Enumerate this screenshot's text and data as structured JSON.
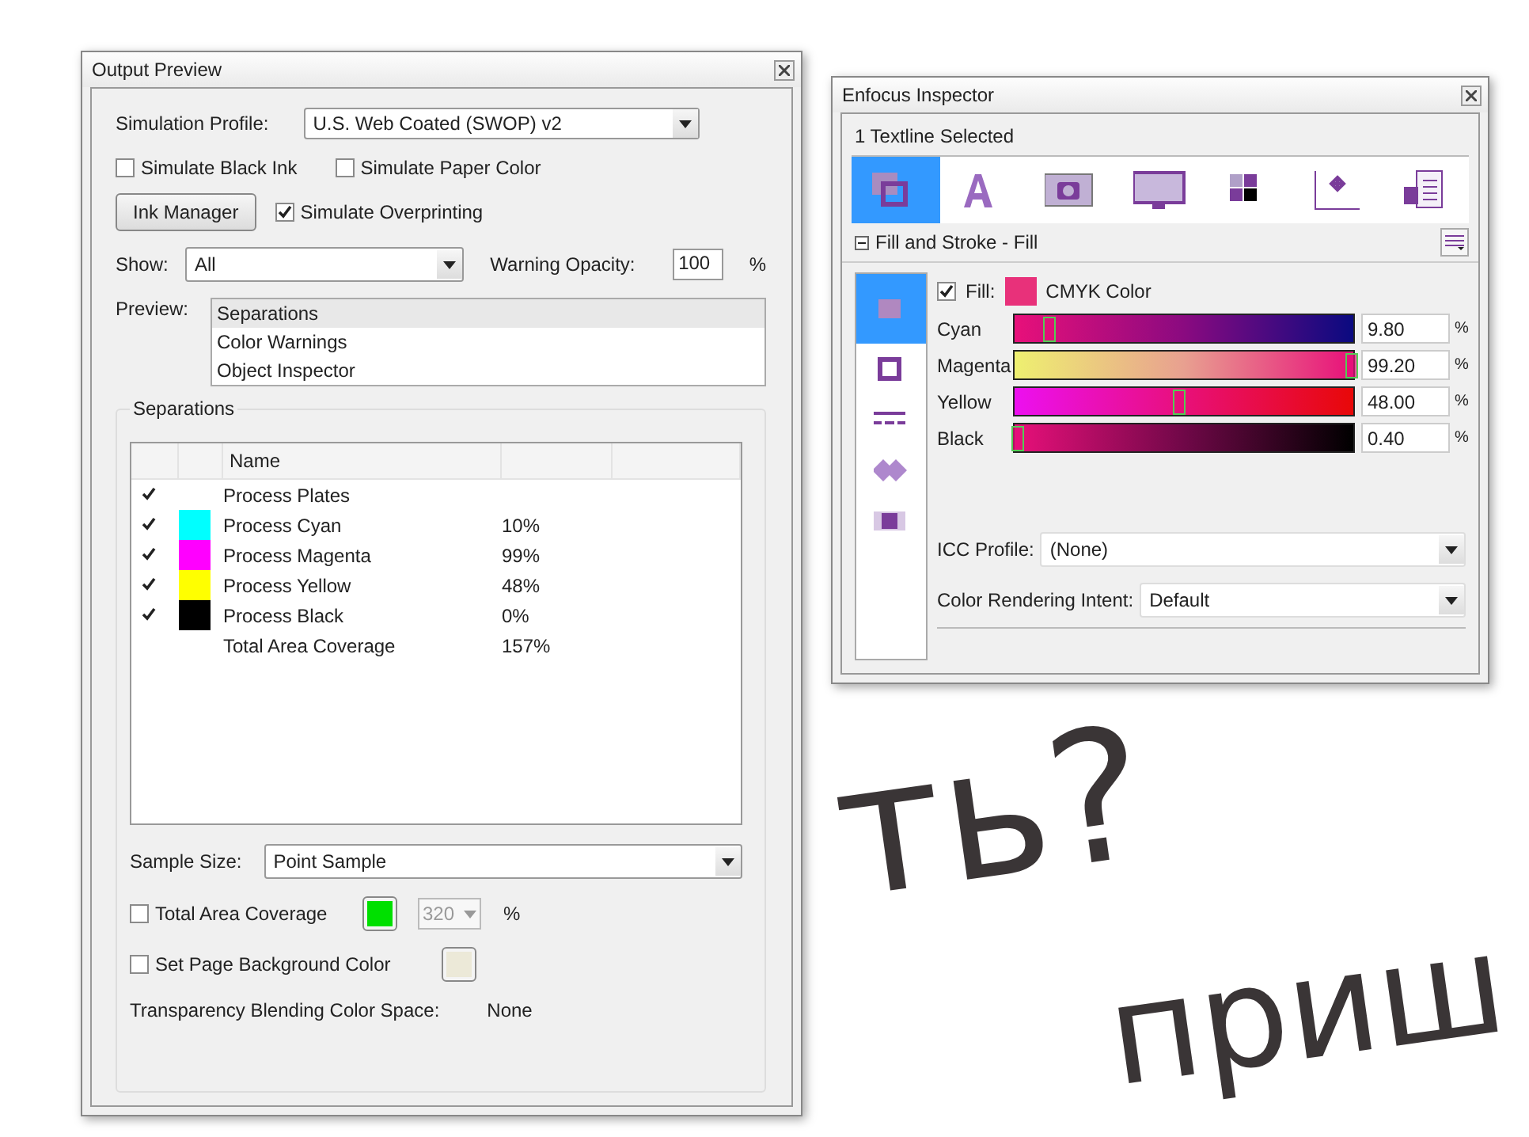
{
  "background_text": [
    {
      "text": "ть?",
      "color": "#3a3536"
    },
    {
      "text": "приш",
      "color": "#3a3536"
    }
  ],
  "output_preview": {
    "title": "Output Preview",
    "simulation_profile": {
      "label": "Simulation Profile:",
      "value": "U.S. Web Coated (SWOP) v2"
    },
    "options": [
      {
        "label": "Simulate Black Ink",
        "checked": false
      },
      {
        "label": "Simulate Paper Color",
        "checked": false
      }
    ],
    "ink_manager_button": "Ink Manager",
    "simulate_overprinting": {
      "label": "Simulate Overprinting",
      "checked": true
    },
    "show": {
      "label": "Show:",
      "value": "All"
    },
    "warning_opacity": {
      "label": "Warning Opacity:",
      "value": "100",
      "unit": "%"
    },
    "preview": {
      "label": "Preview:",
      "items": [
        {
          "label": "Separations",
          "selected": true
        },
        {
          "label": "Color Warnings",
          "selected": false
        },
        {
          "label": "Object Inspector",
          "selected": false
        }
      ]
    },
    "separations": {
      "title": "Separations",
      "columns": [
        "Name"
      ],
      "rows": [
        {
          "kind": "plate",
          "checked": true,
          "name": "Process Plates",
          "value": ""
        },
        {
          "kind": "ink",
          "checked": true,
          "color": "#00ffff",
          "name": "Process Cyan",
          "value": "10%"
        },
        {
          "kind": "ink",
          "checked": true,
          "color": "#ff00ff",
          "name": "Process Magenta",
          "value": "99%"
        },
        {
          "kind": "ink",
          "checked": true,
          "color": "#ffff00",
          "name": "Process Yellow",
          "value": "48%"
        },
        {
          "kind": "ink",
          "checked": true,
          "color": "#000000",
          "name": "Process Black",
          "value": "0%"
        },
        {
          "kind": "total",
          "name": "Total Area Coverage",
          "value": "157%"
        }
      ],
      "sample_size": {
        "label": "Sample Size:",
        "value": "Point Sample"
      },
      "total_area_coverage": {
        "label": "Total Area Coverage",
        "checked": false,
        "color": "#00e000",
        "value": "320",
        "disabled": true,
        "unit": "%"
      },
      "page_background": {
        "label": "Set Page Background Color",
        "checked": false,
        "color": "#ece9d8"
      },
      "transparency": {
        "label": "Transparency Blending Color Space:",
        "value": "None"
      }
    }
  },
  "inspector": {
    "title": "Enfocus Inspector",
    "status": "1 Textline Selected",
    "tabs": [
      {
        "kind": "fill",
        "selected": true
      },
      {
        "kind": "text",
        "selected": false
      },
      {
        "kind": "image",
        "selected": false
      },
      {
        "kind": "monitor",
        "selected": false
      },
      {
        "kind": "color",
        "selected": false
      },
      {
        "kind": "position",
        "selected": false
      },
      {
        "kind": "document",
        "selected": false
      }
    ],
    "section": "Fill and Stroke - Fill",
    "side_tabs": [
      {
        "kind": "fill",
        "selected": true
      },
      {
        "kind": "stroke",
        "selected": false
      },
      {
        "kind": "dash",
        "selected": false
      },
      {
        "kind": "overprint",
        "selected": false
      },
      {
        "kind": "transparency",
        "selected": false
      }
    ],
    "fill": {
      "label": "Fill:",
      "checked": true,
      "color": "#e8317a",
      "mode": "CMYK Color"
    },
    "channels": [
      {
        "name": "Cyan",
        "level": 0.098,
        "value": "9.80",
        "unit": "%"
      },
      {
        "name": "Magenta",
        "level": 0.992,
        "value": "99.20",
        "unit": "%"
      },
      {
        "name": "Yellow",
        "level": 0.48,
        "value": "48.00",
        "unit": "%"
      },
      {
        "name": "Black",
        "level": 0.004,
        "value": "0.40",
        "unit": "%"
      }
    ],
    "icc_profile": {
      "label": "ICC Profile:",
      "value": "(None)"
    },
    "rendering_intent": {
      "label": "Color Rendering Intent:",
      "value": "Default"
    }
  }
}
